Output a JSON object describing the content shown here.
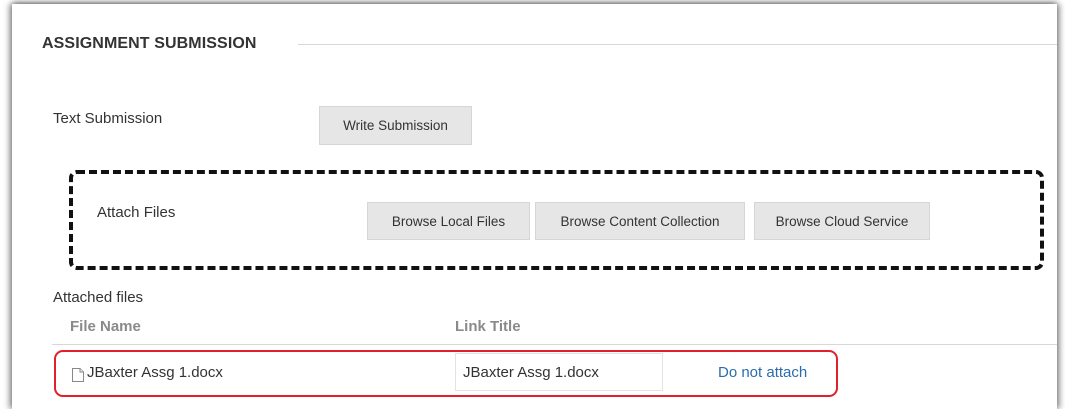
{
  "section": {
    "title": "ASSIGNMENT SUBMISSION"
  },
  "text_submission": {
    "label": "Text Submission",
    "button": "Write Submission"
  },
  "attach_files": {
    "label": "Attach Files",
    "buttons": [
      "Browse Local Files",
      "Browse Content Collection",
      "Browse Cloud Service"
    ]
  },
  "attached_files": {
    "label": "Attached files",
    "columns": [
      "File Name",
      "Link Title"
    ],
    "rows": [
      {
        "icon": "document-icon",
        "file_name": "JBaxter Assg 1.docx",
        "link_title": "JBaxter Assg 1.docx",
        "action": "Do not attach"
      }
    ]
  },
  "colors": {
    "highlight_dashed": "#111111",
    "highlight_red": "#e0202a",
    "link": "#2a6cb0",
    "button_bg": "#e6e6e6"
  }
}
